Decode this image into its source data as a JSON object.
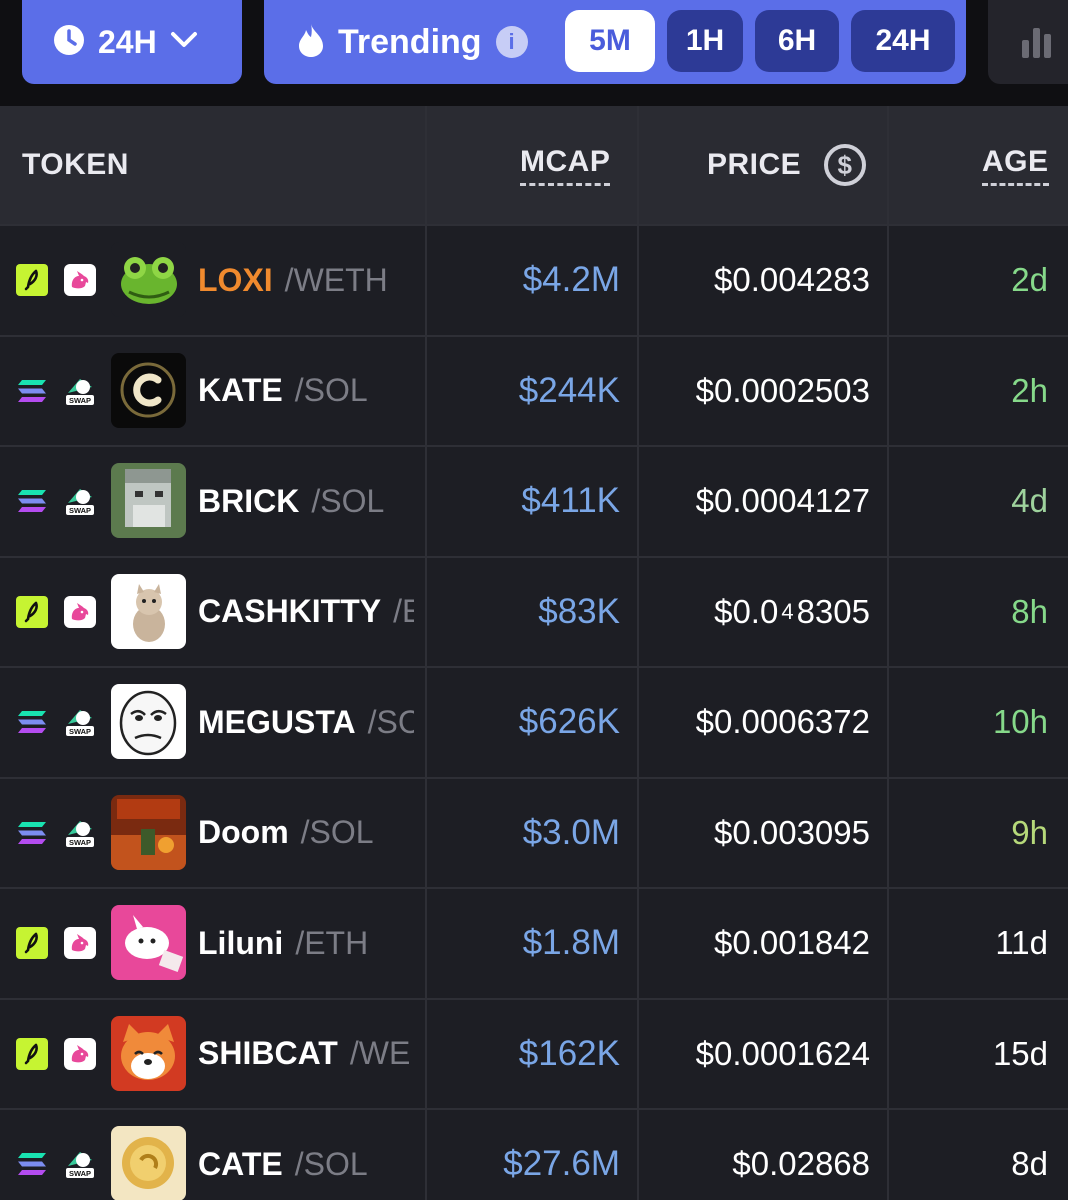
{
  "toolbar": {
    "timeframe_label": "24H",
    "trending_label": "Trending",
    "info_glyph": "i",
    "intervals": [
      {
        "label": "5M",
        "active": true
      },
      {
        "label": "1H",
        "active": false
      },
      {
        "label": "6H",
        "active": false
      },
      {
        "label": "24H",
        "active": false
      }
    ]
  },
  "table": {
    "headers": {
      "token": "TOKEN",
      "mcap": "MCAP",
      "price": "PRICE",
      "age": "AGE"
    },
    "rows": [
      {
        "chain": "bolt-chain-icon",
        "dex": "unicorn-dex-icon",
        "avatar": "chameleon-avatar",
        "symbol": "LOXI",
        "pair": "/WETH",
        "mcap": "$4.2M",
        "price": "$0.004283",
        "age": "2d",
        "symbol_color": "#f08a2e",
        "age_color": "#86d98a"
      },
      {
        "chain": "solana-icon",
        "dex": "swap-dex-icon",
        "avatar": "kate-avatar",
        "symbol": "KATE",
        "pair": "/SOL",
        "mcap": "$244K",
        "price": "$0.0002503",
        "age": "2h",
        "symbol_color": "#ffffff",
        "age_color": "#86d98a"
      },
      {
        "chain": "solana-icon",
        "dex": "swap-dex-icon",
        "avatar": "brick-avatar",
        "symbol": "BRICK",
        "pair": "/SOL",
        "mcap": "$411K",
        "price": "$0.0004127",
        "age": "4d",
        "symbol_color": "#ffffff",
        "age_color": "#9ed29d"
      },
      {
        "chain": "bolt-chain-icon",
        "dex": "unicorn-dex-icon",
        "avatar": "kitten-avatar",
        "symbol": "CASHKITTY",
        "pair": "/E",
        "mcap": "$83K",
        "price_main": "$0.0",
        "price_sub": "4",
        "price_tail": "8305",
        "age": "8h",
        "symbol_color": "#ffffff",
        "age_color": "#86d98a"
      },
      {
        "chain": "solana-icon",
        "dex": "swap-dex-icon",
        "avatar": "megusta-avatar",
        "symbol": "MEGUSTA",
        "pair": "/SC",
        "mcap": "$626K",
        "price": "$0.0006372",
        "age": "10h",
        "symbol_color": "#ffffff",
        "age_color": "#86d98a"
      },
      {
        "chain": "solana-icon",
        "dex": "swap-dex-icon",
        "avatar": "doom-avatar",
        "symbol": "Doom",
        "pair": "/SOL",
        "mcap": "$3.0M",
        "price": "$0.003095",
        "age": "9h",
        "symbol_color": "#ffffff",
        "age_color": "#b6d97a"
      },
      {
        "chain": "bolt-chain-icon",
        "dex": "unicorn-dex-icon",
        "avatar": "liluni-avatar",
        "symbol": "Liluni",
        "pair": "/ETH",
        "mcap": "$1.8M",
        "price": "$0.001842",
        "age": "11d",
        "symbol_color": "#ffffff",
        "age_color": "#ffffff"
      },
      {
        "chain": "bolt-chain-icon",
        "dex": "unicorn-dex-icon",
        "avatar": "shibcat-avatar",
        "symbol": "SHIBCAT",
        "pair": "/WE",
        "mcap": "$162K",
        "price": "$0.0001624",
        "age": "15d",
        "symbol_color": "#ffffff",
        "age_color": "#ffffff"
      },
      {
        "chain": "solana-icon",
        "dex": "swap-dex-icon",
        "avatar": "cate-avatar",
        "symbol": "CATE",
        "pair": "/SOL",
        "mcap": "$27.6M",
        "price": "$0.02868",
        "age": "8d",
        "symbol_color": "#ffffff",
        "age_color": "#ffffff"
      }
    ]
  },
  "colors": {
    "accent": "#5b6ee8",
    "mcap": "#7aa6e6",
    "bolt": "#c6f432",
    "unicorn": "#e8489a"
  }
}
